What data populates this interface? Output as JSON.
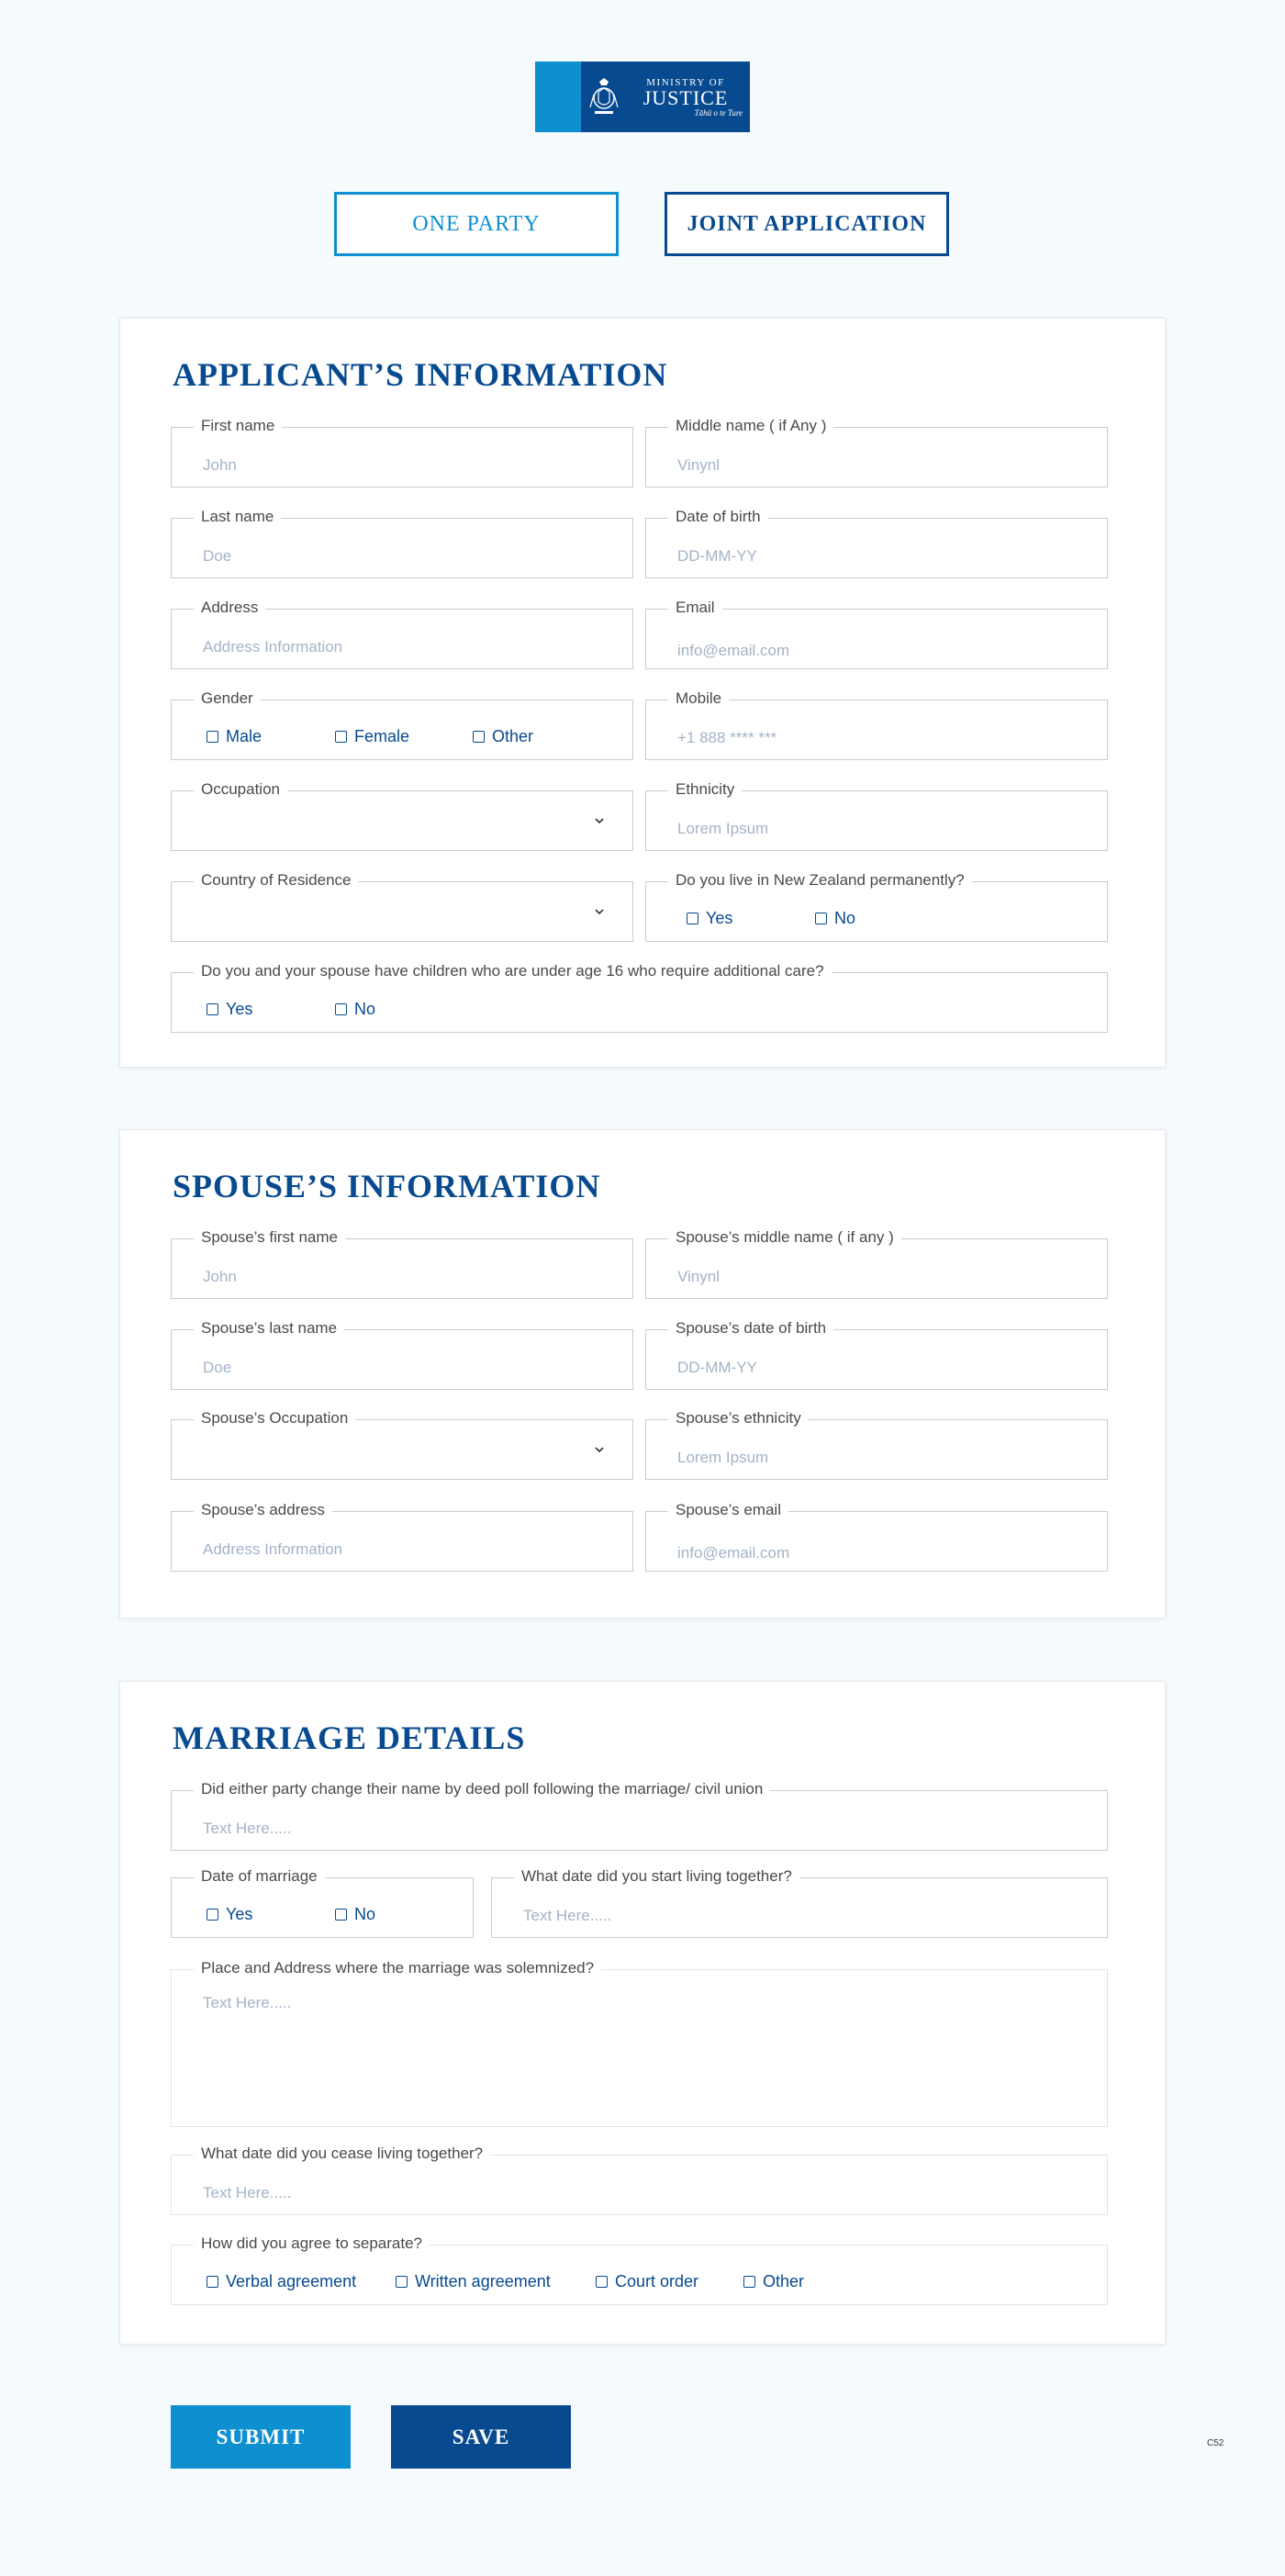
{
  "logo": {
    "line1": "MINISTRY OF",
    "line2": "JUSTICE",
    "line3": "Tāhū o te Ture"
  },
  "mode": {
    "one_party": "ONE PARTY",
    "joint": "JOINT APPLICATION"
  },
  "applicant": {
    "title": "APPLICANT’S INFORMATION",
    "first_name": {
      "label": "First name",
      "placeholder": "John"
    },
    "middle_name": {
      "label": "Middle name ( if Any )",
      "placeholder": "Vinynl"
    },
    "last_name": {
      "label": "Last name",
      "placeholder": "Doe"
    },
    "dob": {
      "label": "Date of birth",
      "placeholder": "DD-MM-YY"
    },
    "address": {
      "label": "Address",
      "placeholder": "Address Information"
    },
    "email": {
      "label": "Email",
      "placeholder": "info@email.com"
    },
    "gender": {
      "label": "Gender",
      "options": [
        "Male",
        "Female",
        "Other"
      ]
    },
    "mobile": {
      "label": "Mobile",
      "placeholder": "+1 888 **** ***"
    },
    "occupation": {
      "label": "Occupation"
    },
    "ethnicity": {
      "label": "Ethnicity",
      "placeholder": "Lorem Ipsum"
    },
    "country": {
      "label": "Country of Residence"
    },
    "nz_permanent": {
      "label": "Do you live in New Zealand permanently?",
      "options": [
        "Yes",
        "No"
      ]
    },
    "children": {
      "label": "Do you and your spouse have children who are under age 16 who require additional care?",
      "options": [
        "Yes",
        "No"
      ]
    }
  },
  "spouse": {
    "title": "SPOUSE’S INFORMATION",
    "first_name": {
      "label": "Spouse’s first name",
      "placeholder": "John"
    },
    "middle_name": {
      "label": "Spouse’s middle name ( if any )",
      "placeholder": "Vinynl"
    },
    "last_name": {
      "label": "Spouse’s last name",
      "placeholder": "Doe"
    },
    "dob": {
      "label": "Spouse’s date of birth",
      "placeholder": "DD-MM-YY"
    },
    "occupation": {
      "label": "Spouse’s Occupation"
    },
    "ethnicity": {
      "label": "Spouse’s ethnicity",
      "placeholder": "Lorem Ipsum"
    },
    "address": {
      "label": "Spouse’s address",
      "placeholder": "Address Information"
    },
    "email": {
      "label": "Spouse’s email",
      "placeholder": "info@email.com"
    }
  },
  "marriage": {
    "title": "MARRIAGE DETAILS",
    "deed_poll": {
      "label": "Did either party change their name by deed poll following the marriage/ civil union",
      "placeholder": "Text Here....."
    },
    "date_of_marriage": {
      "label": "Date of marriage",
      "options": [
        "Yes",
        "No"
      ]
    },
    "living_together": {
      "label": "What date did you start living together?",
      "placeholder": "Text Here....."
    },
    "place": {
      "label": "Place and Address where the marriage was solemnized?",
      "placeholder": "Text Here....."
    },
    "cease": {
      "label": "What date did you cease living together?",
      "placeholder": "Text Here....."
    },
    "separate": {
      "label": "How did you agree to separate?",
      "options": [
        "Verbal agreement",
        "Written agreement",
        "Court order",
        "Other"
      ]
    }
  },
  "actions": {
    "submit": "SUBMIT",
    "save": "SAVE"
  },
  "page_code": "C52",
  "colors": {
    "primary_dark": "#084a8f",
    "primary_light": "#0e8fd0",
    "background": "#f5fafd",
    "placeholder": "#a3b3c7"
  }
}
